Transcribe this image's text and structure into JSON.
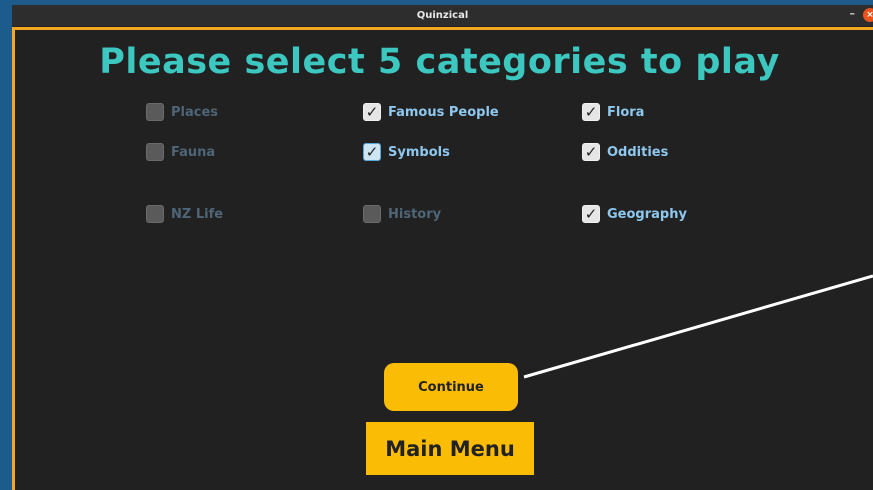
{
  "window": {
    "title": "Quinzical",
    "minimize_glyph": "–",
    "close_glyph": "×"
  },
  "heading": "Please select 5 categories to play",
  "categories": [
    {
      "label": "Places",
      "checked": false
    },
    {
      "label": "Famous People",
      "checked": true
    },
    {
      "label": "Flora",
      "checked": true
    },
    {
      "label": "Fauna",
      "checked": false
    },
    {
      "label": "Symbols",
      "checked": true
    },
    {
      "label": "Oddities",
      "checked": true
    },
    {
      "label": "NZ Life",
      "checked": false
    },
    {
      "label": "History",
      "checked": false
    },
    {
      "label": "Geography",
      "checked": true
    }
  ],
  "check_glyph": "✓",
  "buttons": {
    "continue": "Continue",
    "main_menu": "Main Menu"
  },
  "colors": {
    "accent": "#fbbc05",
    "heading": "#3cc8c0",
    "frame": "#f5a623"
  }
}
